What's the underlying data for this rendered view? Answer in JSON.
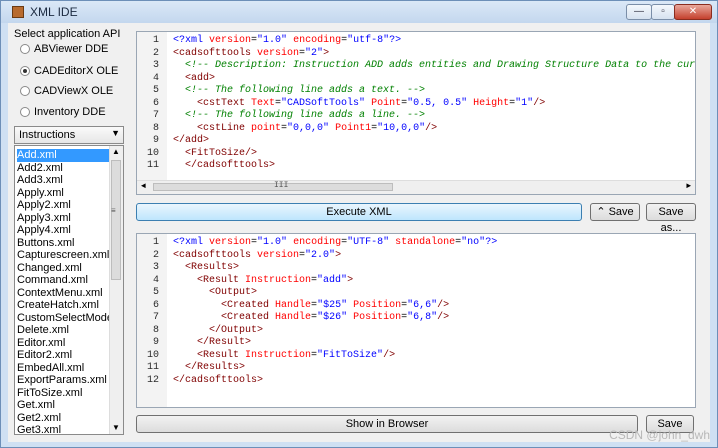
{
  "window": {
    "title": "XML IDE",
    "minimize": "—",
    "maximize": "▫",
    "close": "✕"
  },
  "api": {
    "title": "Select application API",
    "options": [
      {
        "label": "ABViewer DDE",
        "selected": false
      },
      {
        "label": "CADEditorX OLE",
        "selected": true
      },
      {
        "label": "CADViewX OLE",
        "selected": false
      },
      {
        "label": "Inventory DDE",
        "selected": false
      }
    ]
  },
  "combo": {
    "value": "Instructions",
    "arrow": "▼"
  },
  "files": [
    "Add.xml",
    "Add2.xml",
    "Add3.xml",
    "Apply.xml",
    "Apply2.xml",
    "Apply3.xml",
    "Apply4.xml",
    "Buttons.xml",
    "Capturescreen.xml",
    "Changed.xml",
    "Command.xml",
    "ContextMenu.xml",
    "CreateHatch.xml",
    "CustomSelectMode.xr",
    "Delete.xml",
    "Editor.xml",
    "Editor2.xml",
    "EmbedAll.xml",
    "ExportParams.xml",
    "FitToSize.xml",
    "Get.xml",
    "Get2.xml",
    "Get3.xml"
  ],
  "selected_file": "Add.xml",
  "scroll": {
    "up": "▲",
    "down": "▼",
    "left": "◄",
    "right": "►",
    "grip_v": "≡",
    "grip_h": "III"
  },
  "input_editor": {
    "lines": [
      {
        "n": "1",
        "parts": [
          [
            "pi",
            "<?xml "
          ],
          [
            "attr",
            "version"
          ],
          [
            "txt",
            "="
          ],
          [
            "val",
            "\"1.0\""
          ],
          [
            "txt",
            " "
          ],
          [
            "attr",
            "encoding"
          ],
          [
            "txt",
            "="
          ],
          [
            "val",
            "\"utf-8\""
          ],
          [
            "pi",
            "?>"
          ]
        ]
      },
      {
        "n": "2",
        "parts": [
          [
            "tag",
            "<cadsofttools "
          ],
          [
            "attr",
            "version"
          ],
          [
            "txt",
            "="
          ],
          [
            "val",
            "\"2\""
          ],
          [
            "tag",
            ">"
          ]
        ]
      },
      {
        "n": "3",
        "parts": [
          [
            "com",
            "  <!-- Description: Instruction ADD adds entities and Drawing Structure Data to the current"
          ]
        ]
      },
      {
        "n": "4",
        "parts": [
          [
            "tag",
            "  <add>"
          ]
        ]
      },
      {
        "n": "5",
        "parts": [
          [
            "com",
            "  <!-- The following line adds a text. -->"
          ]
        ]
      },
      {
        "n": "6",
        "parts": [
          [
            "tag",
            "    <cstText "
          ],
          [
            "attr",
            "Text"
          ],
          [
            "txt",
            "="
          ],
          [
            "val",
            "\"CADSoftTools\""
          ],
          [
            "txt",
            " "
          ],
          [
            "attr",
            "Point"
          ],
          [
            "txt",
            "="
          ],
          [
            "val",
            "\"0.5, 0.5\""
          ],
          [
            "txt",
            " "
          ],
          [
            "attr",
            "Height"
          ],
          [
            "txt",
            "="
          ],
          [
            "val",
            "\"1\""
          ],
          [
            "tag",
            "/>"
          ]
        ]
      },
      {
        "n": "7",
        "parts": [
          [
            "com",
            "  <!-- The following line adds a line. -->"
          ]
        ]
      },
      {
        "n": "8",
        "parts": [
          [
            "tag",
            "    <cstLine "
          ],
          [
            "attr",
            "point"
          ],
          [
            "txt",
            "="
          ],
          [
            "val",
            "\"0,0,0\""
          ],
          [
            "txt",
            " "
          ],
          [
            "attr",
            "Point1"
          ],
          [
            "txt",
            "="
          ],
          [
            "val",
            "\"10,0,0\""
          ],
          [
            "tag",
            "/>"
          ]
        ]
      },
      {
        "n": "9",
        "parts": [
          [
            "tag",
            "</add>"
          ]
        ]
      },
      {
        "n": "10",
        "parts": [
          [
            "tag",
            "  <FitToSize/>"
          ]
        ]
      },
      {
        "n": "11",
        "parts": [
          [
            "tag",
            "  </cadsofttools>"
          ]
        ]
      }
    ]
  },
  "buttons": {
    "execute": "Execute XML",
    "save": "⌃ Save",
    "save_as": "Save as...",
    "show_browser": "Show in Browser",
    "save_bottom": "Save"
  },
  "output_editor": {
    "lines": [
      {
        "n": "1",
        "parts": [
          [
            "pi",
            "<?xml "
          ],
          [
            "attr",
            "version"
          ],
          [
            "txt",
            "="
          ],
          [
            "val",
            "\"1.0\""
          ],
          [
            "txt",
            " "
          ],
          [
            "attr",
            "encoding"
          ],
          [
            "txt",
            "="
          ],
          [
            "val",
            "\"UTF-8\""
          ],
          [
            "txt",
            " "
          ],
          [
            "attr",
            "standalone"
          ],
          [
            "txt",
            "="
          ],
          [
            "val",
            "\"no\""
          ],
          [
            "pi",
            "?>"
          ]
        ]
      },
      {
        "n": "2",
        "parts": [
          [
            "tag",
            "<cadsofttools "
          ],
          [
            "attr",
            "version"
          ],
          [
            "txt",
            "="
          ],
          [
            "val",
            "\"2.0\""
          ],
          [
            "tag",
            ">"
          ]
        ]
      },
      {
        "n": "3",
        "parts": [
          [
            "tag",
            "  <Results>"
          ]
        ]
      },
      {
        "n": "4",
        "parts": [
          [
            "tag",
            "    <Result "
          ],
          [
            "attr",
            "Instruction"
          ],
          [
            "txt",
            "="
          ],
          [
            "val",
            "\"add\""
          ],
          [
            "tag",
            ">"
          ]
        ]
      },
      {
        "n": "5",
        "parts": [
          [
            "tag",
            "      <Output>"
          ]
        ]
      },
      {
        "n": "6",
        "parts": [
          [
            "tag",
            "        <Created "
          ],
          [
            "attr",
            "Handle"
          ],
          [
            "txt",
            "="
          ],
          [
            "val",
            "\"$25\""
          ],
          [
            "txt",
            " "
          ],
          [
            "attr",
            "Position"
          ],
          [
            "txt",
            "="
          ],
          [
            "val",
            "\"6,6\""
          ],
          [
            "tag",
            "/>"
          ]
        ]
      },
      {
        "n": "7",
        "parts": [
          [
            "tag",
            "        <Created "
          ],
          [
            "attr",
            "Handle"
          ],
          [
            "txt",
            "="
          ],
          [
            "val",
            "\"$26\""
          ],
          [
            "txt",
            " "
          ],
          [
            "attr",
            "Position"
          ],
          [
            "txt",
            "="
          ],
          [
            "val",
            "\"6,8\""
          ],
          [
            "tag",
            "/>"
          ]
        ]
      },
      {
        "n": "8",
        "parts": [
          [
            "tag",
            "      </Output>"
          ]
        ]
      },
      {
        "n": "9",
        "parts": [
          [
            "tag",
            "    </Result>"
          ]
        ]
      },
      {
        "n": "10",
        "parts": [
          [
            "tag",
            "    <Result "
          ],
          [
            "attr",
            "Instruction"
          ],
          [
            "txt",
            "="
          ],
          [
            "val",
            "\"FitToSize\""
          ],
          [
            "tag",
            "/>"
          ]
        ]
      },
      {
        "n": "11",
        "parts": [
          [
            "tag",
            "  </Results>"
          ]
        ]
      },
      {
        "n": "12",
        "parts": [
          [
            "tag",
            "</cadsofttools>"
          ]
        ]
      }
    ]
  },
  "watermark": "CSDN @john_dwh"
}
